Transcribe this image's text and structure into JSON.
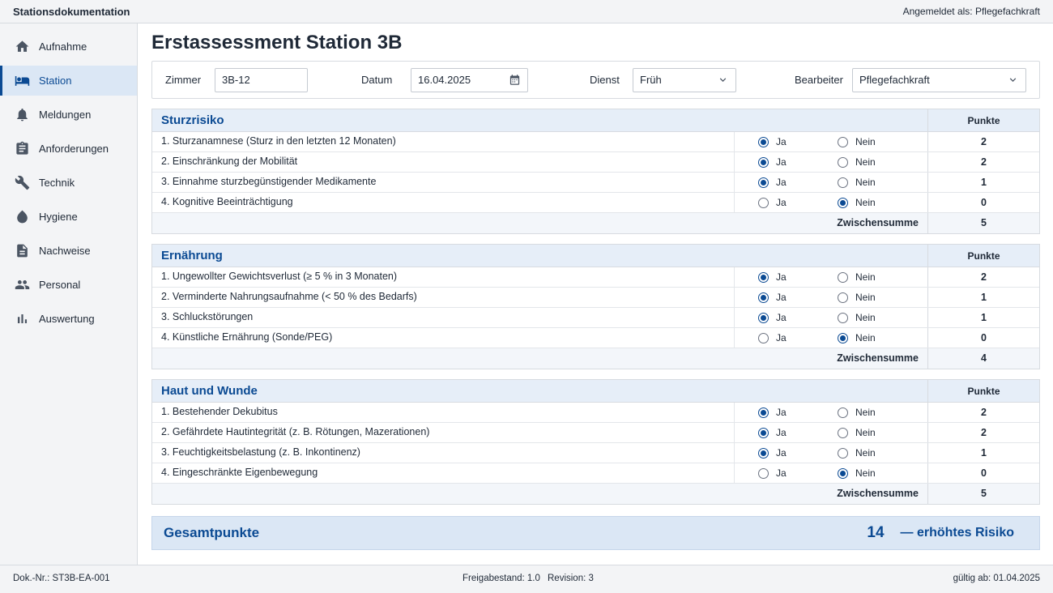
{
  "header": {
    "app_title": "Stationsdokumentation",
    "user": "Angemeldet als: Pflegefachkraft"
  },
  "sidebar": {
    "items": [
      {
        "label": "Aufnahme",
        "icon": "home-icon",
        "active": false
      },
      {
        "label": "Station",
        "icon": "bed-icon",
        "active": true
      },
      {
        "label": "Meldungen",
        "icon": "bell-icon",
        "active": false
      },
      {
        "label": "Anforderungen",
        "icon": "clipboard-icon",
        "active": false
      },
      {
        "label": "Technik",
        "icon": "wrench-icon",
        "active": false
      },
      {
        "label": "Hygiene",
        "icon": "drop-icon",
        "active": false
      },
      {
        "label": "Nachweise",
        "icon": "document-icon",
        "active": false
      },
      {
        "label": "Personal",
        "icon": "people-icon",
        "active": false
      },
      {
        "label": "Auswertung",
        "icon": "bar-chart-icon",
        "active": false
      }
    ]
  },
  "page": {
    "title": "Erstassessment Station 3B"
  },
  "form": {
    "zimmer_label": "Zimmer",
    "zimmer_value": "3B-12",
    "datum_label": "Datum",
    "datum_value": "16.04.2025",
    "dienst_label": "Dienst",
    "dienst_value": "Früh",
    "bearbeiter_label": "Bearbeiter",
    "bearbeiter_value": "Pflegefachkraft"
  },
  "labels": {
    "punkte": "Punkte",
    "ja": "Ja",
    "nein": "Nein",
    "zwischensumme": "Zwischensumme"
  },
  "sections": [
    {
      "title": "Sturzrisiko",
      "rows": [
        {
          "label": "1. Sturzanamnese (Sturz in den letzten 12 Monaten)",
          "answer": "ja",
          "points": "2"
        },
        {
          "label": "2. Einschränkung der Mobilität",
          "answer": "ja",
          "points": "2"
        },
        {
          "label": "3. Einnahme sturzbegünstigender Medikamente",
          "answer": "ja",
          "points": "1"
        },
        {
          "label": "4. Kognitive Beeinträchtigung",
          "answer": "nein",
          "points": "0"
        }
      ],
      "subtotal": "5"
    },
    {
      "title": "Ernährung",
      "rows": [
        {
          "label": "1. Ungewollter Gewichtsverlust (≥ 5 % in 3 Monaten)",
          "answer": "ja",
          "points": "2"
        },
        {
          "label": "2. Verminderte Nahrungsaufnahme (< 50 % des Bedarfs)",
          "answer": "ja",
          "points": "1"
        },
        {
          "label": "3. Schluckstörungen",
          "answer": "ja",
          "points": "1"
        },
        {
          "label": "4. Künstliche Ernährung (Sonde/PEG)",
          "answer": "nein",
          "points": "0"
        }
      ],
      "subtotal": "4"
    },
    {
      "title": "Haut und Wunde",
      "rows": [
        {
          "label": "1. Bestehender Dekubitus",
          "answer": "ja",
          "points": "2"
        },
        {
          "label": "2. Gefährdete Hautintegrität (z. B. Rötungen, Mazerationen)",
          "answer": "ja",
          "points": "2"
        },
        {
          "label": "3. Feuchtigkeitsbelastung (z. B. Inkontinenz)",
          "answer": "ja",
          "points": "1"
        },
        {
          "label": "4. Eingeschränkte Eigenbewegung",
          "answer": "nein",
          "points": "0"
        }
      ],
      "subtotal": "5"
    }
  ],
  "total": {
    "label": "Gesamtpunkte",
    "value": "14",
    "risk": "— erhöhtes Risiko"
  },
  "footer": {
    "doc_nr": "Dok.-Nr.: ST3B-EA-001",
    "freigabe": "Freigabestand: 1.0",
    "revision": "Revision: 3",
    "valid": "gültig ab: 01.04.2025"
  },
  "colors": {
    "accent": "#0b4a93",
    "section_header": "#e6eef8",
    "sidebar_bg": "#f3f4f6"
  }
}
